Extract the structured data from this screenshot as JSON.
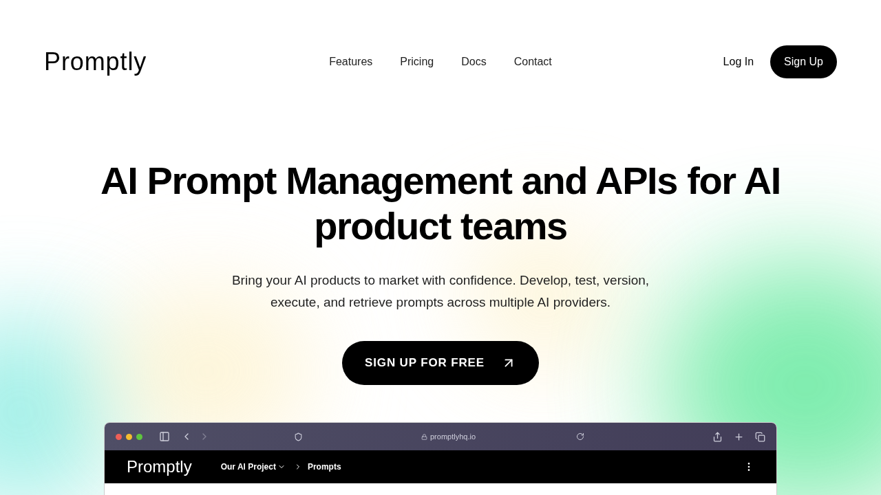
{
  "header": {
    "logo": "Promptly",
    "nav": [
      {
        "label": "Features"
      },
      {
        "label": "Pricing"
      },
      {
        "label": "Docs"
      },
      {
        "label": "Contact"
      }
    ],
    "login": "Log In",
    "signup": "Sign Up"
  },
  "hero": {
    "title": "AI Prompt Management and APIs for AI product teams",
    "subtitle": "Bring your AI products to market with confidence. Develop, test, version, execute, and retrieve prompts across multiple AI providers.",
    "cta": "SIGN UP FOR FREE"
  },
  "browser": {
    "url": "promptlyhq.io",
    "app_logo": "Promptly",
    "project": "Our AI Project",
    "page": "Prompts"
  }
}
